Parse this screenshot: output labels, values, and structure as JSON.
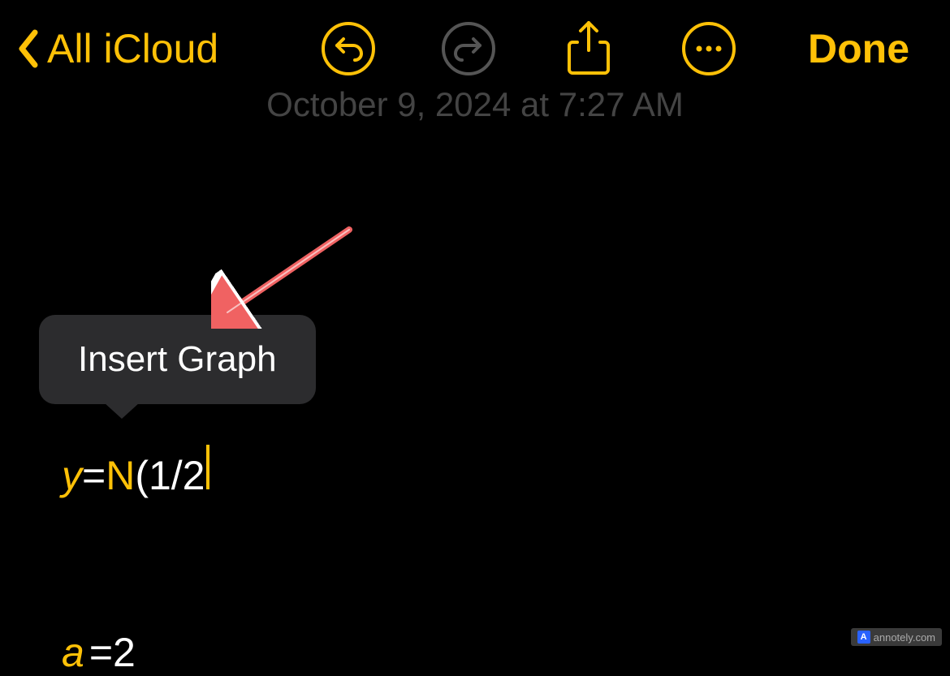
{
  "toolbar": {
    "back_label": "All iCloud",
    "done_label": "Done"
  },
  "timestamp": "October 9, 2024 at 7:27 AM",
  "tooltip": {
    "label": "Insert Graph"
  },
  "equation": {
    "y": "y",
    "eq": "=",
    "n": "N",
    "rest": "(1/2"
  },
  "bottom": {
    "a": "a",
    "rest": "=2"
  },
  "annotation": {
    "watermark": "annotely.com",
    "logo": "A"
  }
}
